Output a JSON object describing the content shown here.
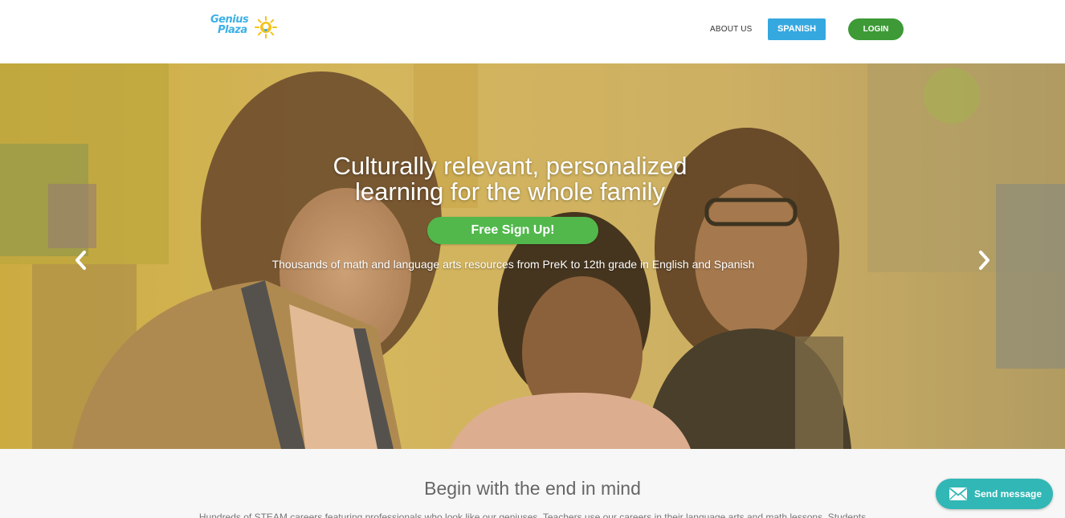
{
  "brand": {
    "logo_line1": "Genius",
    "logo_line2": "Plaza",
    "logo_icon": "lightbulb-sun-icon",
    "colors": {
      "blue": "#35a8e0",
      "green": "#3d9a36",
      "yellow": "#f5c21b",
      "teal": "#31b7b5"
    }
  },
  "nav": {
    "about": "ABOUT US",
    "spanish": "SPANISH",
    "login": "LOGIN"
  },
  "hero": {
    "title_line1": "Culturally relevant, personalized",
    "title_line2": "learning for the whole family",
    "cta": "Free Sign Up!",
    "subtitle": "Thousands of math and language arts resources from PreK to 12th grade in English and Spanish",
    "prev_icon": "chevron-left-icon",
    "next_icon": "chevron-right-icon"
  },
  "section": {
    "title": "Begin with the end in mind",
    "body": "Hundreds of STEAM careers featuring professionals who look like our geniuses. Teachers use our careers in their language arts and math lessons. Students"
  },
  "chat": {
    "label": "Send message",
    "icon": "envelope-icon"
  }
}
